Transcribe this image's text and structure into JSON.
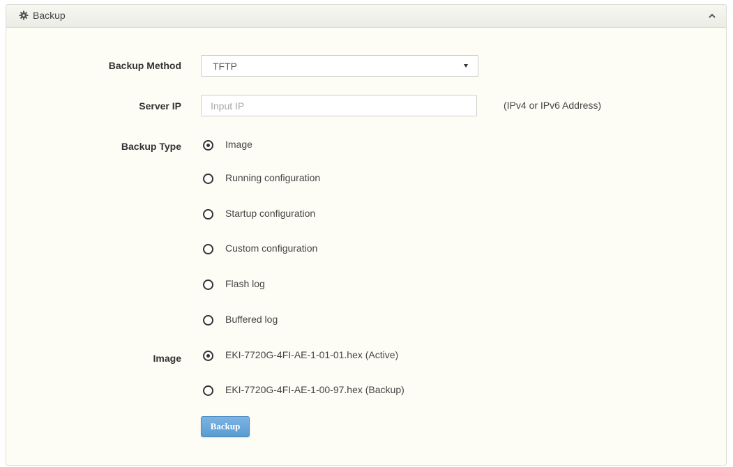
{
  "panel": {
    "title": "Backup",
    "header_icon": "gear-icon",
    "collapse_icon": "chevron-up-icon"
  },
  "form": {
    "backup_method": {
      "label": "Backup Method",
      "selected": "TFTP"
    },
    "server_ip": {
      "label": "Server IP",
      "value": "",
      "placeholder": "Input IP",
      "hint": "(IPv4 or IPv6 Address)"
    },
    "backup_type": {
      "label": "Backup Type",
      "options": [
        {
          "label": "Image",
          "checked": true
        },
        {
          "label": "Running configuration",
          "checked": false
        },
        {
          "label": "Startup configuration",
          "checked": false
        },
        {
          "label": "Custom configuration",
          "checked": false
        },
        {
          "label": "Flash log",
          "checked": false
        },
        {
          "label": "Buffered log",
          "checked": false
        }
      ]
    },
    "image": {
      "label": "Image",
      "options": [
        {
          "label": "EKI-7720G-4FI-AE-1-01-01.hex (Active)",
          "checked": true
        },
        {
          "label": "EKI-7720G-4FI-AE-1-00-97.hex (Backup)",
          "checked": false
        }
      ]
    },
    "submit_label": "Backup"
  },
  "colors": {
    "panel_background": "#fdfdf5",
    "button_blue": "#5a9bd3"
  }
}
